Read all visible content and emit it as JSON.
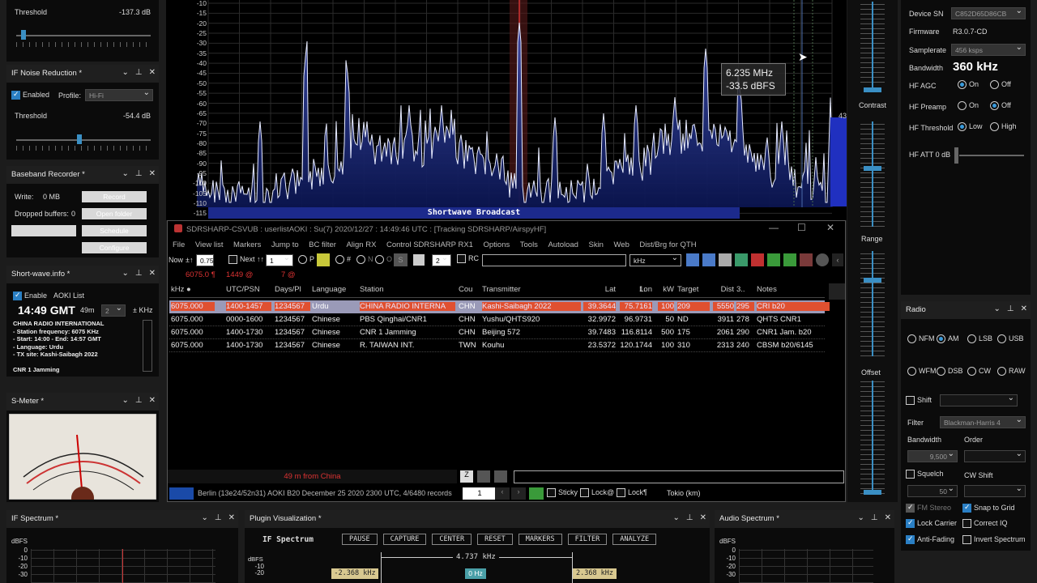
{
  "left": {
    "threshold_top": {
      "label": "Threshold",
      "value": "-137.3 dB"
    },
    "noise_reduction": {
      "title": "IF Noise Reduction *",
      "enabled": "Enabled",
      "profile_label": "Profile:",
      "profile": "Hi-Fi",
      "threshold_label": "Threshold",
      "threshold_value": "-54.4 dB"
    },
    "baseband": {
      "title": "Baseband Recorder *",
      "write_label": "Write:",
      "write_value": "0 MB",
      "dropped_label": "Dropped buffers:",
      "dropped_value": "0",
      "record": "Record",
      "open_folder": "Open folder",
      "schedule": "Schedule",
      "configure": "Configure"
    },
    "shortwave": {
      "title": "Short-wave.info *",
      "enable": "Enable",
      "list": "AOKI List",
      "time": "14:49 GMT",
      "band": "49m",
      "step": "2",
      "unit": "± KHz",
      "info": [
        "CHINA RADIO INTERNATIONAL",
        "- Station frequency: 6075 KHz",
        "- Start: 14:00 - End: 14:57 GMT",
        "- Language: Urdu",
        "- TX site: Kashi-Saibagh 2022",
        "",
        "CNR 1 Jamming"
      ]
    },
    "smeter": {
      "title": "S-Meter *"
    }
  },
  "spectrum": {
    "y_labels": [
      "-10",
      "-15",
      "-20",
      "-25",
      "-30",
      "-35",
      "-40",
      "-45",
      "-50",
      "-55",
      "-60",
      "-65",
      "-70",
      "-75",
      "-80",
      "-85",
      "-90",
      "-95",
      "-100",
      "-105",
      "-110",
      "-115"
    ],
    "tooltip_freq": "6.235 MHz",
    "tooltip_db": "-33.5 dBFS",
    "band_label": "Shortwave Broadcast",
    "right_value": "43"
  },
  "window": {
    "title": "SDRSHARP-CSVUB : userlistAOKI : Su(7) 2020/12/27 : 14:49:46 UTC : [Tracking SDRSHARP/AirspyHF]",
    "menu": [
      "File",
      "View list",
      "Markers",
      "Jump to",
      "BC filter",
      "Align RX",
      "Control SDRSHARP RX1",
      "Options",
      "Tools",
      "Autoload",
      "Skin",
      "Web",
      "Dist/Brg for QTH"
    ],
    "toolbar": {
      "now": "Now",
      "pm": "±↑",
      "step": "0.75",
      "next": "Next ↑↑",
      "next_val": "1",
      "p": "P",
      "hash": "#",
      "n": "N",
      "o": "O",
      "s": "S",
      "two": "2",
      "rc": "RC",
      "unit": "kHz"
    },
    "status_line": {
      "freq": "6075.0 ¶",
      "count": "1449 @",
      "at": "7 @"
    },
    "columns": [
      "kHz ●",
      "UTC/PSN",
      "Days/Pl",
      "Language",
      "Station",
      "Cou",
      "Transmitter",
      "Lat",
      "Lon",
      "1.",
      "kW",
      "Target",
      "Dist",
      "3..",
      "Notes"
    ],
    "rows": [
      [
        "6075.000",
        "1400-1457",
        "1234567",
        "Urdu",
        "CHINA RADIO INTERNA",
        "CHN",
        "Kashi-Saibagh 2022",
        "39.3644",
        "75.7161",
        "",
        "100",
        "209",
        "5550",
        "295",
        "CRI b20"
      ],
      [
        "6075.000",
        "0000-1600",
        "1234567",
        "Chinese",
        "PBS Qinghai/CNR1",
        "CHN",
        "Yushu/QHTS920",
        "32.9972",
        "96.9731",
        "",
        "50",
        "ND",
        "3911",
        "278",
        "QHTS CNR1"
      ],
      [
        "6075.000",
        "1400-1730",
        "1234567",
        "Chinese",
        "CNR 1 Jamming",
        "CHN",
        "Beijing 572",
        "39.7483",
        "116.8114",
        "",
        "500",
        "175",
        "2061",
        "290",
        "CNR1 Jam. b20"
      ],
      [
        "6075.000",
        "1400-1730",
        "1234567",
        "Chinese",
        "R. TAIWAN INT.",
        "TWN",
        "Kouhu",
        "23.5372",
        "120.1744",
        "",
        "100",
        "310",
        "2313",
        "240",
        "CBSM b20/6145"
      ]
    ],
    "bottom_note": "49 m from China",
    "status_bar": "Berlin (13e24/52n31) AOKI B20 December 25 2020 2300 UTC, 4/6480 records",
    "page": "1",
    "sticky": "Sticky",
    "lock_at": "Lock@",
    "lock_para": "Lock¶",
    "tokio": "Tokio (km)"
  },
  "mid": {
    "contrast": "Contrast",
    "range": "Range",
    "offset": "Offset"
  },
  "device": {
    "sn_label": "Device SN",
    "sn": "C852D65D86CB",
    "fw_label": "Firmware",
    "fw": "R3.0.7-CD",
    "sr_label": "Samplerate",
    "sr": "456 ksps",
    "bw_label": "Bandwidth",
    "bw": "360 kHz",
    "agc_label": "HF AGC",
    "preamp_label": "HF Preamp",
    "threshold_label": "HF Threshold",
    "att_label": "HF ATT 0 dB",
    "on": "On",
    "off": "Off",
    "low": "Low",
    "high": "High"
  },
  "radio": {
    "title": "Radio",
    "modes": [
      "NFM",
      "AM",
      "LSB",
      "USB",
      "WFM",
      "DSB",
      "CW",
      "RAW"
    ],
    "shift": "Shift",
    "filter": "Filter",
    "filter_val": "Blackman-Harris 4",
    "bandwidth": "Bandwidth",
    "order": "Order",
    "bw_val": "9,500",
    "squelch": "Squelch",
    "cw_shift": "CW Shift",
    "sq_val": "50",
    "fm_stereo": "FM Stereo",
    "snap": "Snap to Grid",
    "lock_carrier": "Lock Carrier",
    "correct_iq": "Correct IQ",
    "anti_fading": "Anti-Fading",
    "invert": "Invert Spectrum"
  },
  "bottom": {
    "if_spectrum": "IF Spectrum *",
    "plugin": "Plugin Visualization *",
    "audio": "Audio Spectrum *",
    "dbfs": "dBFS",
    "ticks": [
      "0",
      "-10",
      "-20",
      "-30"
    ],
    "plugin_label": "IF Spectrum",
    "buttons": [
      "PAUSE",
      "CAPTURE",
      "CENTER",
      "RESET",
      "MARKERS",
      "FILTER",
      "ANALYZE"
    ],
    "bw": "4.737 kHz",
    "left_hz": "-2.368 kHz",
    "center_hz": "0 Hz",
    "right_hz": "2.368 kHz"
  }
}
